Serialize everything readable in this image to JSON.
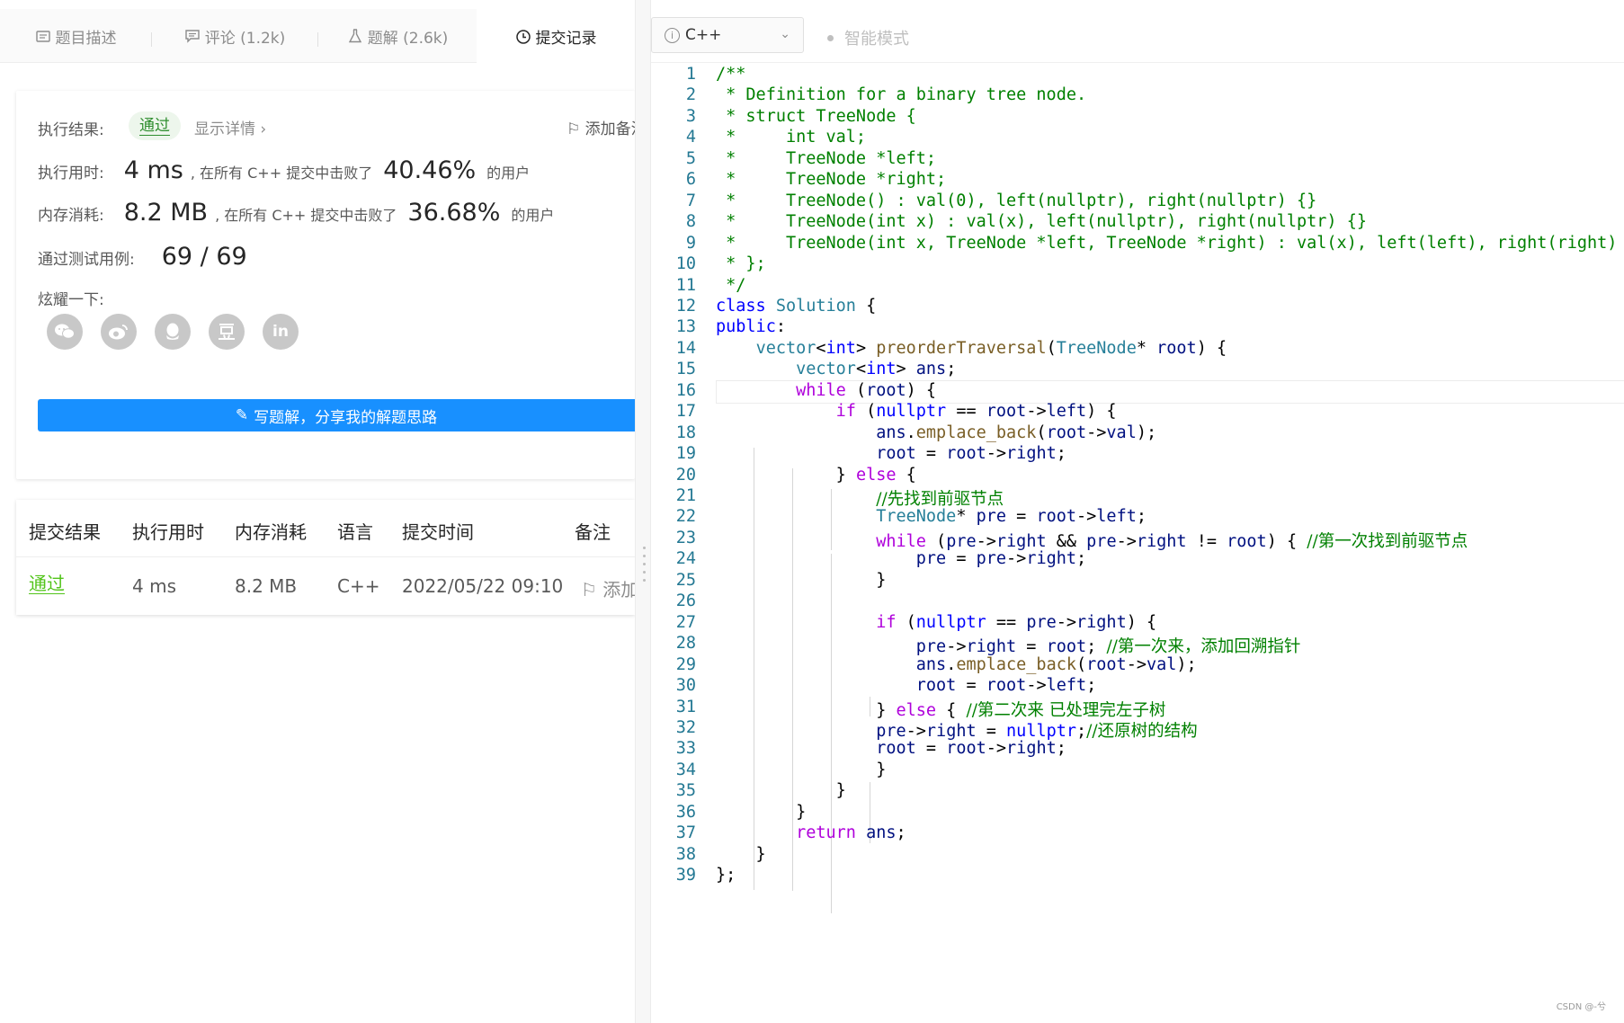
{
  "tabs": [
    {
      "label": "题目描述",
      "icon": "description-icon"
    },
    {
      "label": "评论 (1.2k)",
      "icon": "comment-icon"
    },
    {
      "label": "题解 (2.6k)",
      "icon": "flask-icon"
    },
    {
      "label": "提交记录",
      "icon": "clock-icon",
      "active": true
    }
  ],
  "result": {
    "status_label": "执行结果:",
    "status": "通过",
    "detail_link": "显示详情 ›",
    "add_note": "添加备注",
    "runtime_label": "执行用时:",
    "runtime": "4 ms",
    "runtime_text": ", 在所有 C++ 提交中击败了",
    "runtime_pct": "40.46%",
    "runtime_users": "的用户",
    "memory_label": "内存消耗:",
    "memory": "8.2 MB",
    "memory_text": ", 在所有 C++ 提交中击败了",
    "memory_pct": "36.68%",
    "memory_users": "的用户",
    "tests_label": "通过测试用例:",
    "tests": "69 / 69",
    "share_label": "炫耀一下:",
    "share_icons": [
      "wechat-icon",
      "weibo-icon",
      "qq-icon",
      "douban-icon",
      "linkedin-icon"
    ],
    "write_button": "写题解，分享我的解题思路"
  },
  "submissions": {
    "headers": [
      "提交结果",
      "执行用时",
      "内存消耗",
      "语言",
      "提交时间",
      "备注"
    ],
    "rows": [
      {
        "result": "通过",
        "runtime": "4 ms",
        "memory": "8.2 MB",
        "lang": "C++",
        "time": "2022/05/22 09:10",
        "note": "添加备注"
      }
    ]
  },
  "editor": {
    "language": "C++",
    "smart_mode": "智能模式",
    "current_line": 16,
    "lines": [
      "/**",
      " * Definition for a binary tree node.",
      " * struct TreeNode {",
      " *     int val;",
      " *     TreeNode *left;",
      " *     TreeNode *right;",
      " *     TreeNode() : val(0), left(nullptr), right(nullptr) {}",
      " *     TreeNode(int x) : val(x), left(nullptr), right(nullptr) {}",
      " *     TreeNode(int x, TreeNode *left, TreeNode *right) : val(x), left(left), right(right) {}",
      " * };",
      " */",
      "class Solution {",
      "public:",
      "    vector<int> preorderTraversal(TreeNode* root) {",
      "        vector<int> ans;",
      "        while (root) {",
      "            if (nullptr == root->left) {",
      "                ans.emplace_back(root->val);",
      "                root = root->right;",
      "            } else {",
      "                //先找到前驱节点",
      "                TreeNode* pre = root->left;",
      "                while (pre->right && pre->right != root) { //第一次找到前驱节点",
      "                    pre = pre->right;",
      "                }",
      "",
      "                if (nullptr == pre->right) {",
      "                    pre->right = root; //第一次来，添加回溯指针",
      "                    ans.emplace_back(root->val);",
      "                    root = root->left;",
      "                } else { //第二次来 已处理完左子树",
      "                pre->right = nullptr;//还原树的结构",
      "                root = root->right;",
      "                }",
      "            }",
      "        }",
      "        return ans;",
      "    }",
      "};"
    ]
  },
  "watermark": "CSDN @-兮"
}
